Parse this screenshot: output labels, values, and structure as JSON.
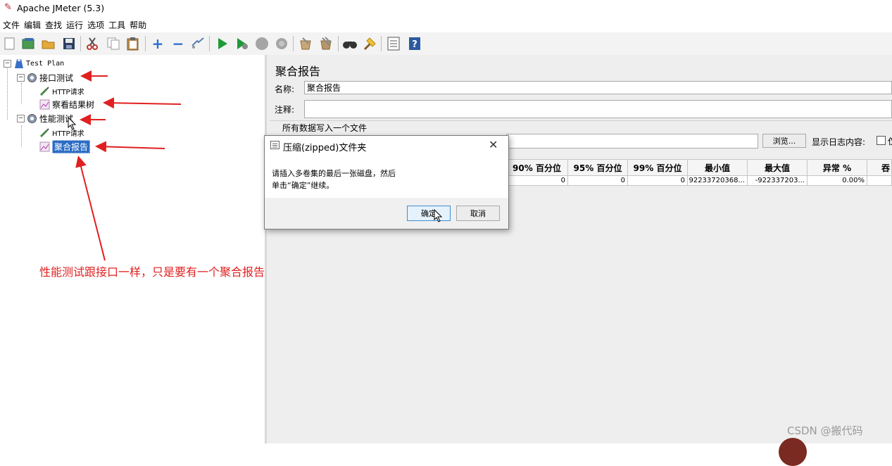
{
  "window": {
    "title": "Apache JMeter (5.3)",
    "icon": "jmeter-feather-icon"
  },
  "menu": [
    "文件",
    "编辑",
    "查找",
    "运行",
    "选项",
    "工具",
    "帮助"
  ],
  "toolbar_icons": [
    "new-icon",
    "templates-icon",
    "open-icon",
    "save-icon",
    "cut-icon",
    "copy-icon",
    "paste-icon",
    "add-icon",
    "remove-icon",
    "toggle-icon",
    "start-icon",
    "start-no-pause-icon",
    "stop-icon",
    "shutdown-icon",
    "clear-icon",
    "clear-all-icon",
    "search-icon",
    "reset-search-icon",
    "function-helper-icon",
    "help-icon"
  ],
  "tree": {
    "root": "Test Plan",
    "group1": "接口测试",
    "group1_http": "HTTP请求",
    "group1_listener": "察看结果树",
    "group2": "性能测试",
    "group2_http": "HTTP请求",
    "group2_listener": "聚合报告"
  },
  "panel": {
    "title": "聚合报告",
    "name_label": "名称:",
    "name_value": "聚合报告",
    "comment_label": "注释:",
    "comment_value": "",
    "file_section": "所有数据写入一个文件",
    "browse_button": "浏览...",
    "log_label": "显示日志内容:",
    "log_option_partial": "仅"
  },
  "table": {
    "headers": [
      "90% 百分位",
      "95% 百分位",
      "99% 百分位",
      "最小值",
      "最大值",
      "异常 %",
      "吞"
    ],
    "row": [
      "0",
      "0",
      "0",
      "92233720368...",
      "-922337203...",
      "0.00%",
      ""
    ]
  },
  "dialog": {
    "title": "压缩(zipped)文件夹",
    "message_line1": "请插入多卷集的最后一张磁盘，然后",
    "message_line2": "单击“确定”继续。",
    "ok": "确定",
    "cancel": "取消"
  },
  "annotation": "性能测试跟接口一样，只是要有一个聚合报告",
  "watermark": "CSDN @搬代码",
  "colors": {
    "selection": "#2b6cc5",
    "annotation_red": "#e02020",
    "panel_bg": "#eeeeee"
  }
}
